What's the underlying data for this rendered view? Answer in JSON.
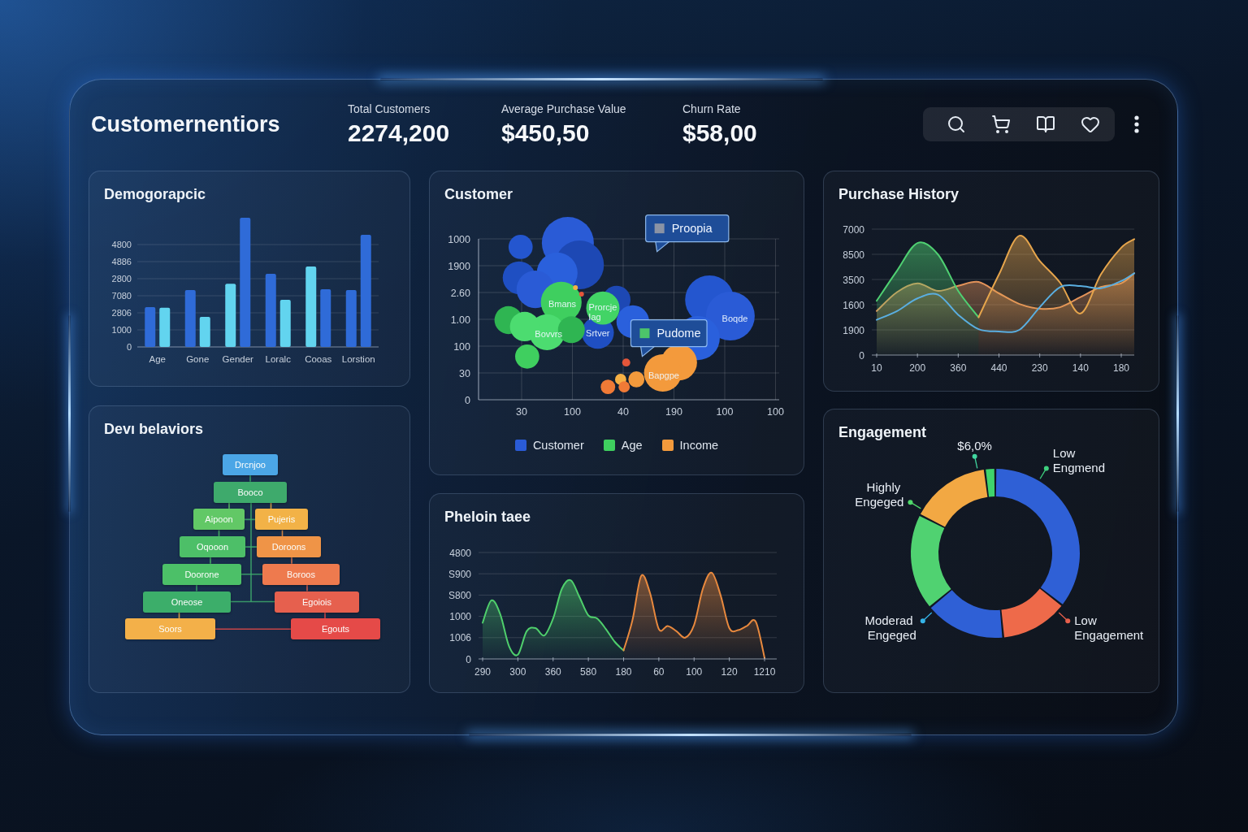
{
  "header": {
    "title": "Customernentiors",
    "kpis": [
      {
        "label": "Total Customers",
        "value": "2274,200"
      },
      {
        "label": "Average Purchase Value",
        "value": "$450,50"
      },
      {
        "label": "Churn Rate",
        "value": "$58,00"
      }
    ]
  },
  "columns": [
    {
      "panels": [
        {
          "kind": "bar_chart",
          "title": "Demogorapcic",
          "y_axis_labels": [
            "4800",
            "4886",
            "2800",
            "7080",
            "2806",
            "1000",
            "0"
          ],
          "x_axis_labels": [
            "Age",
            "Gone",
            "Gender",
            "Loralc",
            "Cooas",
            "Lorstion"
          ]
        },
        {
          "kind": "tree",
          "title": "Devı belaviors",
          "tree": {
            "label": "Drcnjoo",
            "color": "#4ba6e6",
            "children": [
              {
                "label": "Booco",
                "color": "#3eaa6c",
                "children": [
                  {
                    "label": "Aipoon",
                    "color": "#62c866",
                    "children": [
                      {
                        "label": "Oqooon",
                        "color": "#4dbf68",
                        "children": [
                          {
                            "label": "Doorone",
                            "color": "#4cc068",
                            "children": [
                              {
                                "label": "Oneose",
                                "color": "#3cae6a",
                                "children": [
                                  {
                                    "label": "Soors",
                                    "color": "#f3b049"
                                  }
                                ]
                              }
                            ]
                          }
                        ]
                      }
                    ]
                  },
                  {
                    "label": "Pujeris",
                    "color": "#f2b247",
                    "children": [
                      {
                        "label": "Doroons",
                        "color": "#ef9447",
                        "children": [
                          {
                            "label": "Boroos",
                            "color": "#ee7a4e",
                            "children": [
                              {
                                "label": "Egoiois",
                                "color": "#e6604e",
                                "children": [
                                  {
                                    "label": "Egouts",
                                    "color": "#e54a48"
                                  }
                                ]
                              }
                            ]
                          }
                        ]
                      }
                    ]
                  }
                ]
              }
            ]
          }
        }
      ]
    },
    {
      "panels": [
        {
          "kind": "bubble_chart",
          "title": "Customer",
          "y_axis_labels": [
            "1000",
            "1900",
            "2.60",
            "1.00",
            "100",
            "30",
            "0"
          ],
          "x_axis_labels": [
            "30",
            "100",
            "40",
            "190",
            "100",
            "100"
          ],
          "bubble_labels": [
            "Bmans",
            "Prorcje",
            "Iag",
            "Boqde",
            "Bovvrs",
            "Srtver",
            "Bapgpe"
          ],
          "callouts": [
            {
              "text": "Proopia",
              "color": "#8a93a5"
            },
            {
              "text": "Pudome",
              "color": "#4cc46a"
            }
          ],
          "legend": [
            {
              "name": "Customer",
              "color": "#2a5bd6"
            },
            {
              "name": "Age",
              "color": "#3fcf5f"
            },
            {
              "name": "Income",
              "color": "#f39a3c"
            }
          ]
        },
        {
          "kind": "area_chart",
          "title": "Pheloin taee",
          "y_axis_labels": [
            "4800",
            "S900",
            "S800",
            "1000",
            "1006",
            "0"
          ],
          "x_axis_labels": [
            "290",
            "300",
            "360",
            "580",
            "180",
            "60",
            "100",
            "120",
            "1210"
          ]
        }
      ]
    },
    {
      "panels": [
        {
          "kind": "line_chart",
          "title": "Purchase History",
          "y_axis_labels": [
            "7000",
            "8500",
            "3500",
            "1600",
            "1900",
            "0"
          ],
          "x_axis_labels": [
            "10",
            "200",
            "360",
            "440",
            "230",
            "140",
            "180"
          ]
        },
        {
          "kind": "donut_chart",
          "title": "Engagement",
          "chart_data": {
            "type": "donut",
            "series": [
              {
                "values": [
                  2,
                  35.5,
                  13,
                  15.5,
                  18.5,
                  15.5
                ],
                "colors": [
                  "#3fd46c",
                  "#2f60d6",
                  "#ee6a4a",
                  "#2f60d6",
                  "#50d271",
                  "#f2a843"
                ]
              }
            ],
            "annotations": [
              "$6,0%",
              "Low Engmend",
              "Highly Engeged",
              "Moderad Engeged",
              "Low Engagement"
            ]
          }
        }
      ]
    }
  ]
}
